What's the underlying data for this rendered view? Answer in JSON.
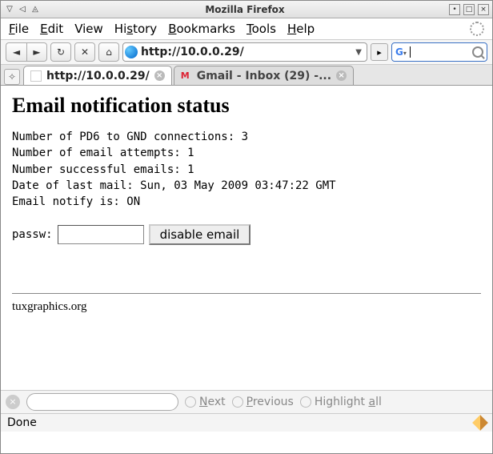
{
  "window": {
    "title": "Mozilla Firefox"
  },
  "menubar": {
    "file": "File",
    "edit": "Edit",
    "view": "View",
    "history": "History",
    "bookmarks": "Bookmarks",
    "tools": "Tools",
    "help": "Help"
  },
  "toolbar": {
    "url": "http://10.0.0.29/"
  },
  "tabs": {
    "tab0_label": "http://10.0.0.29/",
    "tab1_label": "Gmail - Inbox (29) -..."
  },
  "page": {
    "heading": "Email notification status",
    "line1": "Number of PD6 to GND connections: 3",
    "line2": "Number of email attempts: 1",
    "line3": "Number successful emails: 1",
    "line4": "Date of last mail: Sun, 03 May 2009 03:47:22 GMT",
    "line5": "Email notify is: ON",
    "passw_label": "passw:",
    "disable_label": "disable email",
    "footer": "tuxgraphics.org"
  },
  "findbar": {
    "next": "Next",
    "previous": "Previous",
    "highlight": "Highlight all"
  },
  "status": {
    "text": "Done"
  }
}
